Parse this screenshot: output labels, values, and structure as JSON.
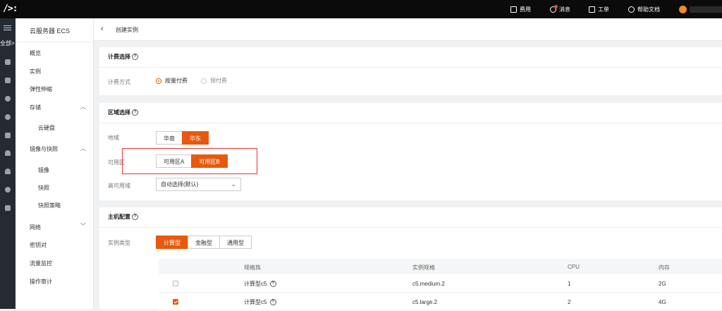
{
  "topbar": {
    "logo": "/>:",
    "items": [
      {
        "label": "费用",
        "icon": "bill-icon"
      },
      {
        "label": "消息",
        "icon": "message-icon"
      },
      {
        "label": "工单",
        "icon": "ticket-icon"
      },
      {
        "label": "帮助文档",
        "icon": "help-icon"
      }
    ],
    "avatar_icon": "user-avatar-icon"
  },
  "rail": {
    "all_label": "全部>",
    "icons": [
      "home-icon",
      "database-icon",
      "globe-icon",
      "globe-alt-icon",
      "storage-icon",
      "cloud-upload-icon",
      "cloud-icon",
      "close-circle-icon",
      "database-stack-icon"
    ]
  },
  "sidebar": {
    "title": "云服务器 ECS",
    "items": [
      {
        "label": "概览"
      },
      {
        "label": "实例"
      },
      {
        "label": "弹性伸缩"
      },
      {
        "label": "存储",
        "chevron": "up"
      },
      {
        "label": "云硬盘"
      },
      {
        "label": "镜像与快照",
        "chevron": "up"
      },
      {
        "label": "镜像"
      },
      {
        "label": "快照"
      },
      {
        "label": "快照策略"
      },
      {
        "label": "网络",
        "chevron": "down"
      },
      {
        "label": "密钥对"
      },
      {
        "label": "流量监控"
      },
      {
        "label": "操作审计"
      }
    ]
  },
  "header": {
    "back_icon": "back-arrow-icon",
    "title": "创建实例"
  },
  "billing": {
    "title": "计费选择",
    "method_label": "计费方式",
    "options": [
      {
        "label": "按量付费",
        "selected": true
      },
      {
        "label": "预付费",
        "selected": false
      }
    ]
  },
  "region": {
    "title": "区域选择",
    "region_label": "地域",
    "regions": [
      {
        "label": "华南",
        "selected": false
      },
      {
        "label": "华东",
        "selected": true
      }
    ],
    "zone_label": "可用区",
    "zones": [
      {
        "label": "可用区A",
        "selected": false
      },
      {
        "label": "可用区B",
        "selected": true
      }
    ],
    "ha_label": "高可用域",
    "ha_value": "自动选择(默认)"
  },
  "host": {
    "title": "主机配置",
    "type_label": "实例类型",
    "types": [
      {
        "label": "计算型",
        "selected": true
      },
      {
        "label": "金融型",
        "selected": false
      },
      {
        "label": "通用型",
        "selected": false
      }
    ],
    "table": {
      "headers": [
        "规格族",
        "实例规格",
        "CPU",
        "内存"
      ],
      "rows": [
        {
          "checked": false,
          "family": "计算型c5",
          "spec": "c5.medium.2",
          "cpu": "1",
          "mem": "2G"
        },
        {
          "checked": true,
          "family": "计算型c5",
          "spec": "c5.large.2",
          "cpu": "2",
          "mem": "4G"
        }
      ]
    }
  },
  "colors": {
    "accent": "#e8590c",
    "topbar": "#0b0b0b",
    "rail": "#242b33",
    "highlight": "#ee3333"
  }
}
